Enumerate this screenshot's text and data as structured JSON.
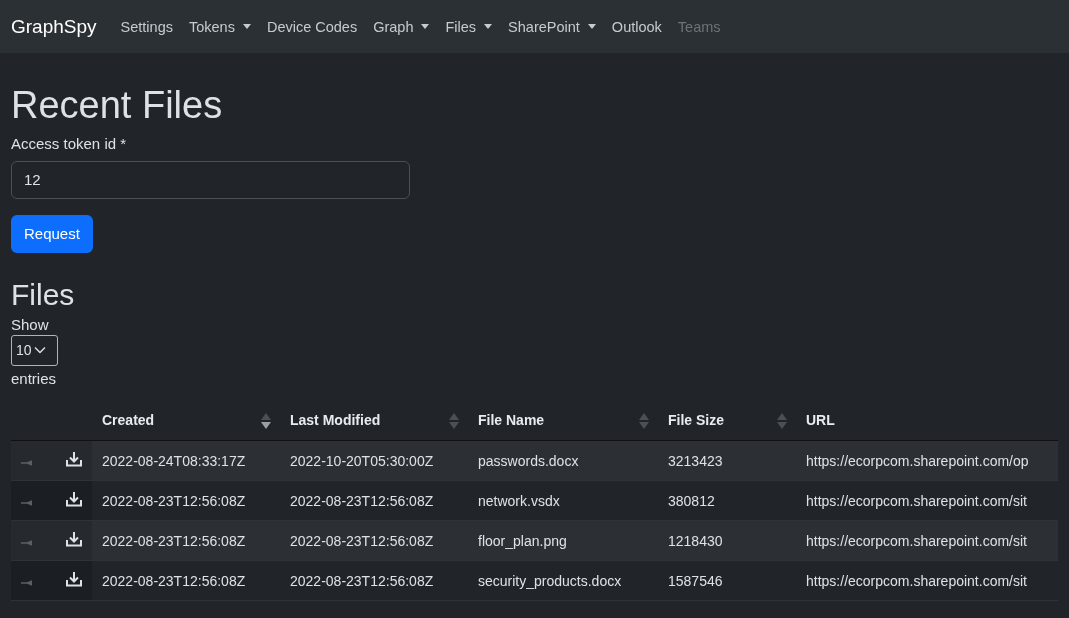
{
  "navbar": {
    "brand": "GraphSpy",
    "items": [
      {
        "label": "Settings",
        "dropdown": false,
        "disabled": false
      },
      {
        "label": "Tokens",
        "dropdown": true,
        "disabled": false
      },
      {
        "label": "Device Codes",
        "dropdown": false,
        "disabled": false
      },
      {
        "label": "Graph",
        "dropdown": true,
        "disabled": false
      },
      {
        "label": "Files",
        "dropdown": true,
        "disabled": false
      },
      {
        "label": "SharePoint",
        "dropdown": true,
        "disabled": false
      },
      {
        "label": "Outlook",
        "dropdown": false,
        "disabled": false
      },
      {
        "label": "Teams",
        "dropdown": false,
        "disabled": true
      }
    ]
  },
  "page_title": "Recent Files",
  "token_field": {
    "label": "Access token id *",
    "value": "12"
  },
  "request_button": "Request",
  "files": {
    "title": "Files",
    "show_label": "Show",
    "page_size": "10",
    "entries_label": "entries",
    "columns": [
      {
        "label": "Created",
        "sortable": true,
        "sorted_descending": true
      },
      {
        "label": "Last Modified",
        "sortable": true,
        "sorted_descending": false
      },
      {
        "label": "File Name",
        "sortable": true,
        "sorted_descending": false
      },
      {
        "label": "File Size",
        "sortable": true,
        "sorted_descending": false
      },
      {
        "label": "URL",
        "sortable": false
      }
    ],
    "rows": [
      {
        "cells": [
          "2022-08-24T08:33:17Z",
          "2022-10-20T05:30:00Z",
          "passwords.docx",
          "3213423",
          "https://ecorpcom.sharepoint.com/op"
        ]
      },
      {
        "cells": [
          "2022-08-23T12:56:08Z",
          "2022-08-23T12:56:08Z",
          "network.vsdx",
          "380812",
          "https://ecorpcom.sharepoint.com/sit"
        ]
      },
      {
        "cells": [
          "2022-08-23T12:56:08Z",
          "2022-08-23T12:56:08Z",
          "floor_plan.png",
          "1218430",
          "https://ecorpcom.sharepoint.com/sit"
        ]
      },
      {
        "cells": [
          "2022-08-23T12:56:08Z",
          "2022-08-23T12:56:08Z",
          "security_products.docx",
          "1587546",
          "https://ecorpcom.sharepoint.com/sit"
        ]
      }
    ]
  }
}
